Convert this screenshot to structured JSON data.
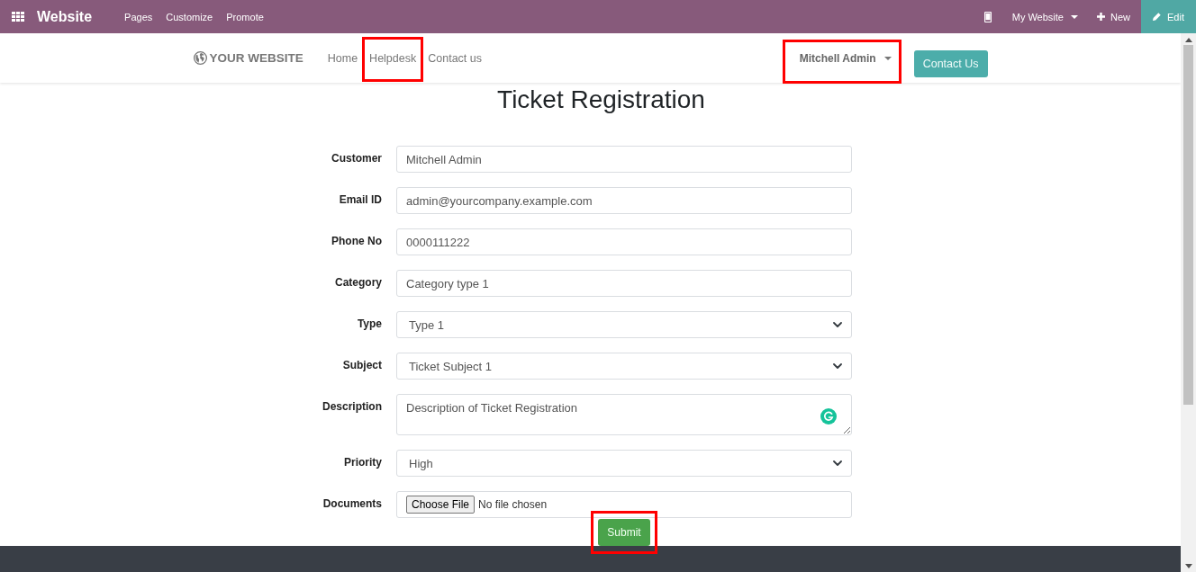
{
  "admin_bar": {
    "app_title": "Website",
    "menu": [
      "Pages",
      "Customize",
      "Promote"
    ],
    "website_switcher": "My Website",
    "new_button": "New",
    "edit_button": "Edit"
  },
  "header": {
    "logo": "YOUR WEBSITE",
    "nav": [
      {
        "label": "Home",
        "highlighted": false
      },
      {
        "label": "Helpdesk",
        "highlighted": true
      },
      {
        "label": "Contact us",
        "highlighted": false
      }
    ],
    "user_menu": {
      "label": "Mitchell Admin",
      "highlighted": true
    },
    "contact_button": "Contact Us"
  },
  "page_title": "Ticket Registration",
  "form": {
    "fields": [
      {
        "kind": "text",
        "label": "Customer",
        "value": "Mitchell Admin"
      },
      {
        "kind": "text",
        "label": "Email ID",
        "value": "admin@yourcompany.example.com"
      },
      {
        "kind": "text",
        "label": "Phone No",
        "value": "0000111222"
      },
      {
        "kind": "text",
        "label": "Category",
        "value": "Category type 1"
      },
      {
        "kind": "select",
        "label": "Type",
        "value": "Type 1"
      },
      {
        "kind": "select",
        "label": "Subject",
        "value": "Ticket Subject 1"
      },
      {
        "kind": "textarea",
        "label": "Description",
        "value": "Description of Ticket Registration"
      },
      {
        "kind": "select",
        "label": "Priority",
        "value": "High"
      },
      {
        "kind": "file",
        "label": "Documents",
        "button": "Choose File",
        "status": "No file chosen"
      }
    ],
    "submit": {
      "label": "Submit",
      "highlighted": true
    }
  }
}
